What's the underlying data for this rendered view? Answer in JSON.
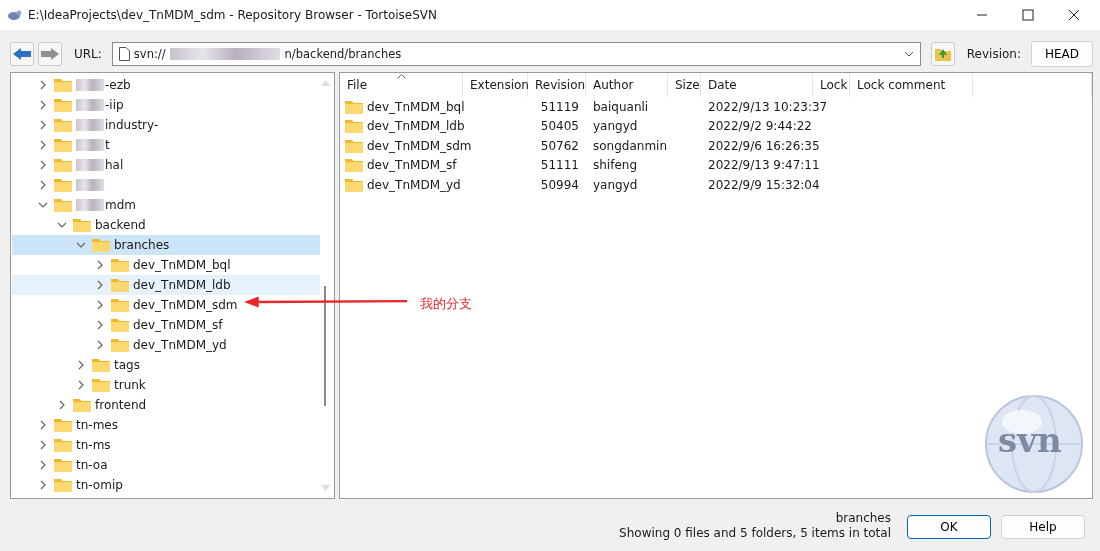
{
  "window": {
    "title": "E:\\IdeaProjects\\dev_TnMDM_sdm - Repository Browser - TortoiseSVN"
  },
  "toolbar": {
    "url_label": "URL:",
    "url_prefix": "svn://",
    "url_suffix": "n/backend/branches",
    "revision_label": "Revision:",
    "revision": "HEAD"
  },
  "tree": [
    {
      "label": "-ezb",
      "redacted": true,
      "expanded": false,
      "selected": false,
      "highlighted": false
    },
    {
      "label": "-iip",
      "redacted": true,
      "expanded": false,
      "selected": false,
      "highlighted": false
    },
    {
      "label": "industry-",
      "redacted": true,
      "expanded": false,
      "selected": false,
      "highlighted": false
    },
    {
      "label": "t",
      "redacted": true,
      "expanded": false,
      "selected": false,
      "highlighted": false
    },
    {
      "label": "hal",
      "redacted": true,
      "expanded": false,
      "selected": false,
      "highlighted": false
    },
    {
      "redacted": true,
      "expanded": false,
      "selected": false,
      "highlighted": false
    },
    {
      "label": "mdm",
      "redacted": true,
      "expanded": true,
      "selected": false,
      "highlighted": false,
      "children": [
        {
          "label": "backend",
          "redacted": false,
          "expanded": true,
          "selected": false,
          "highlighted": false,
          "children": [
            {
              "label": "branches",
              "redacted": false,
              "expanded": true,
              "selected": true,
              "highlighted": false,
              "children": [
                {
                  "label": "dev_TnMDM_bql",
                  "redacted": false,
                  "expanded": false,
                  "selected": false,
                  "highlighted": false
                },
                {
                  "label": "dev_TnMDM_ldb",
                  "redacted": false,
                  "expanded": false,
                  "selected": false,
                  "highlighted": true
                },
                {
                  "label": "dev_TnMDM_sdm",
                  "redacted": false,
                  "expanded": false,
                  "selected": false,
                  "highlighted": false
                },
                {
                  "label": "dev_TnMDM_sf",
                  "redacted": false,
                  "expanded": false,
                  "selected": false,
                  "highlighted": false
                },
                {
                  "label": "dev_TnMDM_yd",
                  "redacted": false,
                  "expanded": false,
                  "selected": false,
                  "highlighted": false
                }
              ]
            },
            {
              "label": "tags",
              "redacted": false,
              "expanded": false,
              "selected": false,
              "highlighted": false
            },
            {
              "label": "trunk",
              "redacted": false,
              "expanded": false,
              "selected": false,
              "highlighted": false
            }
          ]
        },
        {
          "label": "frontend",
          "redacted": false,
          "expanded": false,
          "selected": false,
          "highlighted": false
        }
      ]
    },
    {
      "label": "tn-mes",
      "redacted": false,
      "expanded": false,
      "selected": false,
      "highlighted": false
    },
    {
      "label": "tn-ms",
      "redacted": false,
      "expanded": false,
      "selected": false,
      "highlighted": false
    },
    {
      "label": "tn-oa",
      "redacted": false,
      "expanded": false,
      "selected": false,
      "highlighted": false
    },
    {
      "label": "tn-omip",
      "redacted": false,
      "expanded": false,
      "selected": false,
      "highlighted": false
    }
  ],
  "table": {
    "columns": [
      "File",
      "Extension",
      "Revision",
      "Author",
      "Size",
      "Date",
      "Lock",
      "Lock comment"
    ],
    "rows": [
      [
        "dev_TnMDM_bql",
        "",
        "51119",
        "baiquanli",
        "",
        "2022/9/13 10:23:37",
        "",
        ""
      ],
      [
        "dev_TnMDM_ldb",
        "",
        "50405",
        "yangyd",
        "",
        "2022/9/2 9:44:22",
        "",
        ""
      ],
      [
        "dev_TnMDM_sdm",
        "",
        "50762",
        "songdanmin",
        "",
        "2022/9/6 16:26:35",
        "",
        ""
      ],
      [
        "dev_TnMDM_sf",
        "",
        "51111",
        "shifeng",
        "",
        "2022/9/13 9:47:11",
        "",
        ""
      ],
      [
        "dev_TnMDM_yd",
        "",
        "50994",
        "yangyd",
        "",
        "2022/9/9 15:32:04",
        "",
        ""
      ]
    ]
  },
  "logo_text": "svn",
  "annotation": {
    "text": "我的分支"
  },
  "status_bar": {
    "path": "branches",
    "summary": "Showing 0 files and 5 folders, 5 items in total"
  },
  "buttons": [
    "OK",
    "Help"
  ]
}
